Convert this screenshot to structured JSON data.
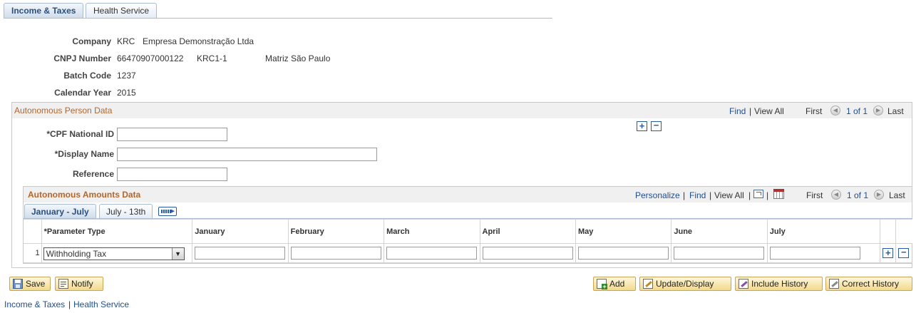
{
  "tabs": [
    "Income & Taxes",
    "Health Service"
  ],
  "header": {
    "company_label": "Company",
    "company_code": "KRC",
    "company_name": "Empresa Demonstração Ltda",
    "cnpj_label": "CNPJ Number",
    "cnpj_number": "66470907000122",
    "cnpj_code": "KRC1-1",
    "cnpj_location": "Matriz São Paulo",
    "batch_label": "Batch Code",
    "batch_code": "1237",
    "year_label": "Calendar Year",
    "year": "2015"
  },
  "autonomous_person": {
    "title": "Autonomous Person Data",
    "nav": {
      "find": "Find",
      "view_all": "View All",
      "first": "First",
      "range": "1 of 1",
      "last": "Last"
    },
    "fields": {
      "cpf_label": "*CPF National ID",
      "display_name_label": "*Display Name",
      "reference_label": "Reference"
    }
  },
  "amounts": {
    "title": "Autonomous Amounts Data",
    "nav": {
      "personalize": "Personalize",
      "find": "Find",
      "view_all": "View All",
      "first": "First",
      "range": "1 of 1",
      "last": "Last"
    },
    "tabs": [
      "January - July",
      "July - 13th"
    ],
    "columns": [
      "*Parameter Type",
      "January",
      "February",
      "March",
      "April",
      "May",
      "June",
      "July"
    ],
    "rows": [
      {
        "num": "1",
        "parameter_type": "Withholding Tax"
      }
    ]
  },
  "buttons": {
    "save": "Save",
    "notify": "Notify",
    "add": "Add",
    "update_display": "Update/Display",
    "include_history": "Include History",
    "correct_history": "Correct History"
  },
  "footer_links": [
    "Income & Taxes",
    "Health Service"
  ],
  "colors": {
    "section_title": "#b4662a",
    "link": "#1f4d8f",
    "button_bg": "#f3d98c"
  }
}
